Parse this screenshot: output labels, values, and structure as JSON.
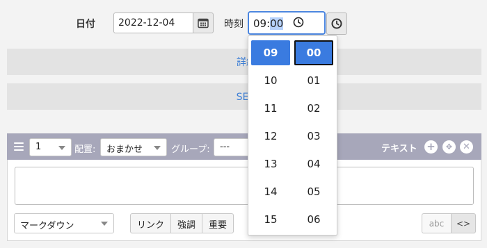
{
  "header": {
    "date_label": "日付",
    "date_value": "2022-12-04",
    "time_label": "時刻",
    "time_hour": "09",
    "time_sep": ":",
    "time_minute": "00"
  },
  "sections": {
    "detail_label": "詳細設",
    "seo_label": "SEO設"
  },
  "block": {
    "order_value": "1",
    "placement_label": "配置:",
    "placement_value": "おまかせ",
    "group_label": "グループ:",
    "group_value": "---",
    "type_label": "テキスト",
    "icons": [
      "plus-icon",
      "move-icon",
      "close-icon"
    ],
    "format_value": "マークダウン",
    "buttons": [
      "リンク",
      "強調",
      "重要"
    ],
    "mode_abc": "abc",
    "mode_code": "<>"
  },
  "picker": {
    "hours": [
      "09",
      "10",
      "11",
      "12",
      "13",
      "14",
      "15"
    ],
    "minutes": [
      "00",
      "01",
      "02",
      "03",
      "04",
      "05",
      "06"
    ],
    "selected_hour": "09",
    "selected_minute": "00"
  },
  "colors": {
    "accent": "#3a7be0",
    "link": "#3d7fd6",
    "block_header": "#a7a7ba"
  }
}
